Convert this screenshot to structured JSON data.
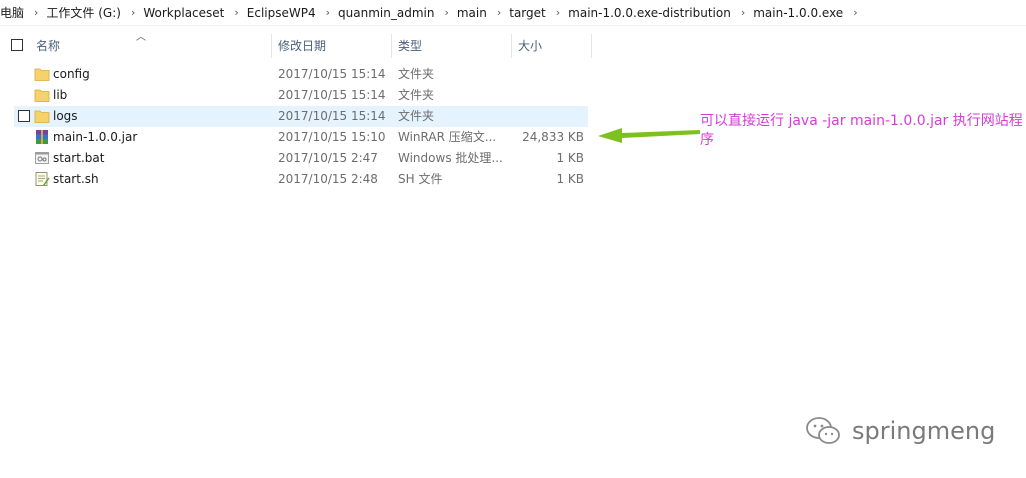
{
  "breadcrumb": [
    "电脑",
    "工作文件 (G:)",
    "Workplaceset",
    "EclipseWP4",
    "quanmin_admin",
    "main",
    "target",
    "main-1.0.0.exe-distribution",
    "main-1.0.0.exe"
  ],
  "columns": {
    "name": "名称",
    "date": "修改日期",
    "type": "类型",
    "size": "大小"
  },
  "files": [
    {
      "name": "config",
      "date": "2017/10/15 15:14",
      "type": "文件夹",
      "size": "",
      "icon": "folder-icon"
    },
    {
      "name": "lib",
      "date": "2017/10/15 15:14",
      "type": "文件夹",
      "size": "",
      "icon": "folder-icon"
    },
    {
      "name": "logs",
      "date": "2017/10/15 15:14",
      "type": "文件夹",
      "size": "",
      "icon": "folder-icon"
    },
    {
      "name": "main-1.0.0.jar",
      "date": "2017/10/15 15:10",
      "type": "WinRAR 压缩文...",
      "size": "24,833 KB",
      "icon": "winrar-archive-icon"
    },
    {
      "name": "start.bat",
      "date": "2017/10/15 2:47",
      "type": "Windows 批处理...",
      "size": "1 KB",
      "icon": "batch-file-icon"
    },
    {
      "name": "start.sh",
      "date": "2017/10/15 2:48",
      "type": "SH 文件",
      "size": "1 KB",
      "icon": "shell-script-icon"
    }
  ],
  "annotation": {
    "text": "可以直接运行 java -jar main-1.0.0.jar 执行网站程序",
    "color": "#d63cd6",
    "arrow_color": "#7cc11f"
  },
  "watermark": {
    "text": "springmeng"
  },
  "colors": {
    "hover_row": "#e5f3ff",
    "header_text": "#4c607a",
    "folder": "#f5d36a"
  }
}
